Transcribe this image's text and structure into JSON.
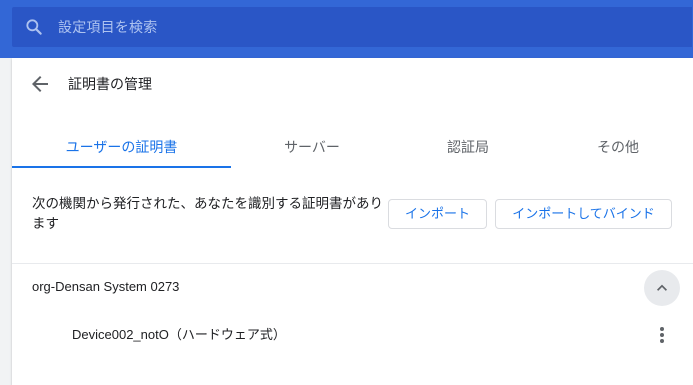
{
  "search": {
    "placeholder": "設定項目を検索",
    "icon": "search-icon"
  },
  "page": {
    "title": "証明書の管理",
    "back_icon": "arrow-back-icon"
  },
  "tabs": [
    {
      "label": "ユーザーの証明書",
      "active": true
    },
    {
      "label": "サーバー",
      "active": false
    },
    {
      "label": "認証局",
      "active": false
    },
    {
      "label": "その他",
      "active": false
    }
  ],
  "description": "次の機関から発行された、あなたを識別する証明書があります",
  "buttons": {
    "import": "インポート",
    "import_bind": "インポートしてバインド"
  },
  "org": {
    "name": "org-Densan System 0273",
    "expanded": true
  },
  "certificates": [
    {
      "name": "Device002_notO（ハードウェア式）"
    }
  ],
  "colors": {
    "header": "#3367d6",
    "accent": "#1a73e8",
    "background": "#f1f3f4"
  }
}
